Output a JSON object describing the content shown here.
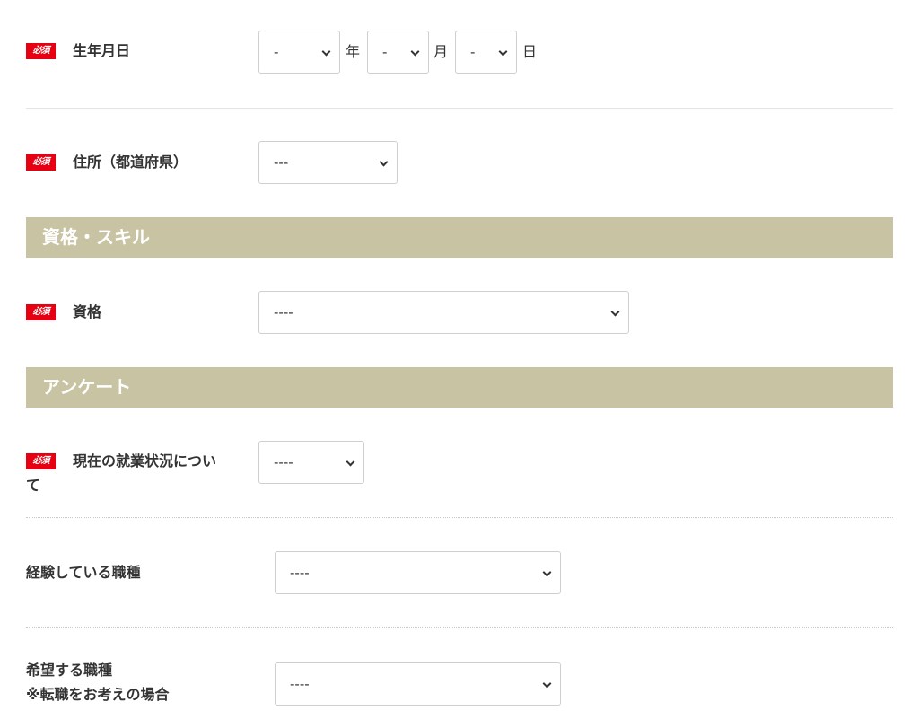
{
  "required_badge": "必須",
  "birthdate": {
    "label": "生年月日",
    "year": {
      "value": "-",
      "unit": "年"
    },
    "month": {
      "value": "-",
      "unit": "月"
    },
    "day": {
      "value": "-",
      "unit": "日"
    }
  },
  "prefecture": {
    "label": "住所（都道府県）",
    "value": "---"
  },
  "section_skills": {
    "title": "資格・スキル"
  },
  "qualification": {
    "label": "資格",
    "value": "----"
  },
  "section_survey": {
    "title": "アンケート"
  },
  "employment_status": {
    "label_line1": "現在の就業状況につい",
    "label_line2": "て",
    "value": "----"
  },
  "experienced_job": {
    "label": "経験している職種",
    "value": "----"
  },
  "desired_job": {
    "label_line1": "希望する職種",
    "label_line2": "※転職をお考えの場合",
    "value": "----"
  },
  "colors": {
    "required": "#e60012",
    "section_bar": "#c8c3a2"
  }
}
